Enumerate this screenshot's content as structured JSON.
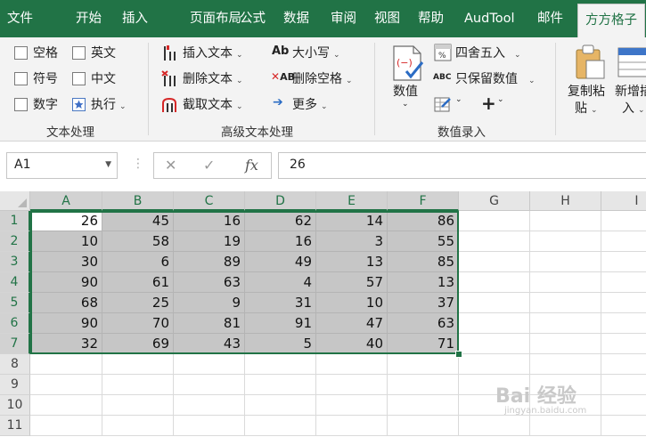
{
  "ribbon_tabs": [
    "文件",
    "开始",
    "插入",
    "页面布局",
    "公式",
    "数据",
    "审阅",
    "视图",
    "帮助",
    "AudTool",
    "邮件",
    "方方格子"
  ],
  "active_tab": "方方格子",
  "groups": {
    "text_processing": {
      "label": "文本处理",
      "checkbox_space": "空格",
      "checkbox_english": "英文",
      "checkbox_symbol": "符号",
      "checkbox_chinese": "中文",
      "checkbox_number": "数字",
      "execute": "执行"
    },
    "advanced_text": {
      "label": "高级文本处理",
      "insert_text": "插入文本",
      "delete_text": "删除文本",
      "extract_text": "截取文本",
      "case": "大小写",
      "delete_space": "删除空格",
      "more": "更多",
      "case_icon_text": "Ab",
      "space_icon_text": "AB"
    },
    "data_entry": {
      "label": "数值录入",
      "value": "数值",
      "round": "四舍五入",
      "keep_value": "只保留数值",
      "keep_value_icon_text": "ABC",
      "plus": "+"
    },
    "clipboard": {
      "copy_paste_line1": "复制粘",
      "copy_paste_line2": "贴",
      "new_insert_line1": "新增插",
      "new_insert_line2": "入"
    }
  },
  "formula_bar": {
    "name_box": "A1",
    "fx": "fx",
    "cancel": "✕",
    "enter": "✓",
    "value": "26"
  },
  "columns": [
    "A",
    "B",
    "C",
    "D",
    "E",
    "F",
    "G",
    "H",
    "I"
  ],
  "rows": [
    "1",
    "2",
    "3",
    "4",
    "5",
    "6",
    "7",
    "8",
    "9",
    "10",
    "11"
  ],
  "cells": [
    [
      26,
      45,
      16,
      62,
      14,
      86
    ],
    [
      10,
      58,
      19,
      16,
      3,
      55
    ],
    [
      30,
      6,
      89,
      49,
      13,
      85
    ],
    [
      90,
      61,
      63,
      4,
      57,
      13
    ],
    [
      68,
      25,
      9,
      31,
      10,
      37
    ],
    [
      90,
      70,
      81,
      91,
      47,
      63
    ],
    [
      32,
      69,
      43,
      5,
      40,
      71
    ]
  ],
  "selection": "A1:F7",
  "watermark": {
    "text": "Bai 经验",
    "url_text": "jingyan.baidu.com"
  },
  "colors": {
    "excel_green": "#217346",
    "selection_fill": "#c6c6c6"
  }
}
